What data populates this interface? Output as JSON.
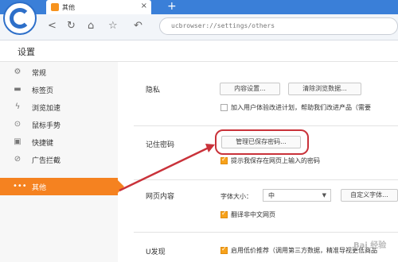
{
  "browser": {
    "tab_title": "其他",
    "new_tab": "+",
    "url": "ucbrowser://settings/others"
  },
  "page": {
    "title": "设置"
  },
  "sidebar": {
    "items": [
      {
        "label": "常规",
        "icon": "gear-icon"
      },
      {
        "label": "标签页",
        "icon": "tabs-icon"
      },
      {
        "label": "浏览加速",
        "icon": "lightning-icon"
      },
      {
        "label": "鼠标手势",
        "icon": "mouse-icon"
      },
      {
        "label": "快捷键",
        "icon": "keyboard-icon"
      },
      {
        "label": "广告拦截",
        "icon": "block-icon"
      },
      {
        "label": "其他",
        "icon": "more-icon",
        "active": true
      }
    ]
  },
  "privacy": {
    "label": "隐私",
    "content_settings": "内容设置...",
    "clear_data": "清除浏览数据...",
    "ux_program": "加入用户体验改进计划，帮助我们改进产品（需要",
    "ux_program_checked": false
  },
  "passwords": {
    "label": "记住密码",
    "manage": "管理已保存密码...",
    "prompt_save": "提示我保存在网页上输入的密码",
    "prompt_save_checked": true
  },
  "web_content": {
    "label": "网页内容",
    "font_size_label": "字体大小：",
    "font_size_value": "中",
    "custom_font": "自定义字体...",
    "translate": "翻译非中文网页",
    "translate_checked": true
  },
  "u_discover": {
    "label": "U发现",
    "low_price": "启用低价推荐（调用第三方数据，精准导视更低商品",
    "low_price_checked": true
  },
  "accent_color": "#f58220"
}
